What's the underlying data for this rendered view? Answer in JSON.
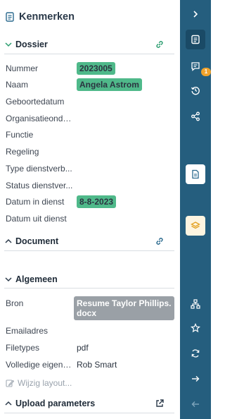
{
  "header": {
    "title": "Kenmerken",
    "icon": "document-icon"
  },
  "dossier": {
    "title": "Dossier",
    "rows": [
      {
        "label": "Nummer",
        "value": "2023005",
        "chip": true
      },
      {
        "label": "Naam",
        "value": "Angela Astrom",
        "chip": true
      },
      {
        "label": "Geboortedatum",
        "value": ""
      },
      {
        "label": "Organisatieonde...",
        "value": ""
      },
      {
        "label": "Functie",
        "value": ""
      },
      {
        "label": "Regeling",
        "value": ""
      },
      {
        "label": "Type dienstverb...",
        "value": ""
      },
      {
        "label": "Status dienstver...",
        "value": ""
      },
      {
        "label": "Datum in dienst",
        "value": "8-8-2023",
        "chip": true
      },
      {
        "label": "Datum uit dienst",
        "value": ""
      }
    ]
  },
  "document": {
    "title": "Document"
  },
  "algemeen": {
    "title": "Algemeen",
    "rows": [
      {
        "label": "Bron",
        "value": "Resume Taylor Phillips.docx",
        "chip": true
      },
      {
        "label": "Emailadres",
        "value": ""
      },
      {
        "label": "Filetypes",
        "value": "pdf"
      },
      {
        "label": "Volledige eigena...",
        "value": "Rob Smart"
      }
    ]
  },
  "edit_layout": "Wijzig layout...",
  "upload": {
    "title": "Upload parameters"
  },
  "rail": {
    "badge_count": "1",
    "icons": [
      "chevron-right-icon",
      "properties-icon",
      "comments-icon",
      "history-icon",
      "share-icon",
      "document-card-icon",
      "layers-card-icon",
      "hierarchy-icon",
      "star-icon",
      "refresh-icon",
      "arrow-right-icon",
      "arrow-left-icon"
    ]
  },
  "colors": {
    "accent": "#255e7e",
    "chip_green": "#4fb98a",
    "chip_grey": "#9aa0a6",
    "badge": "#f0a22b"
  }
}
